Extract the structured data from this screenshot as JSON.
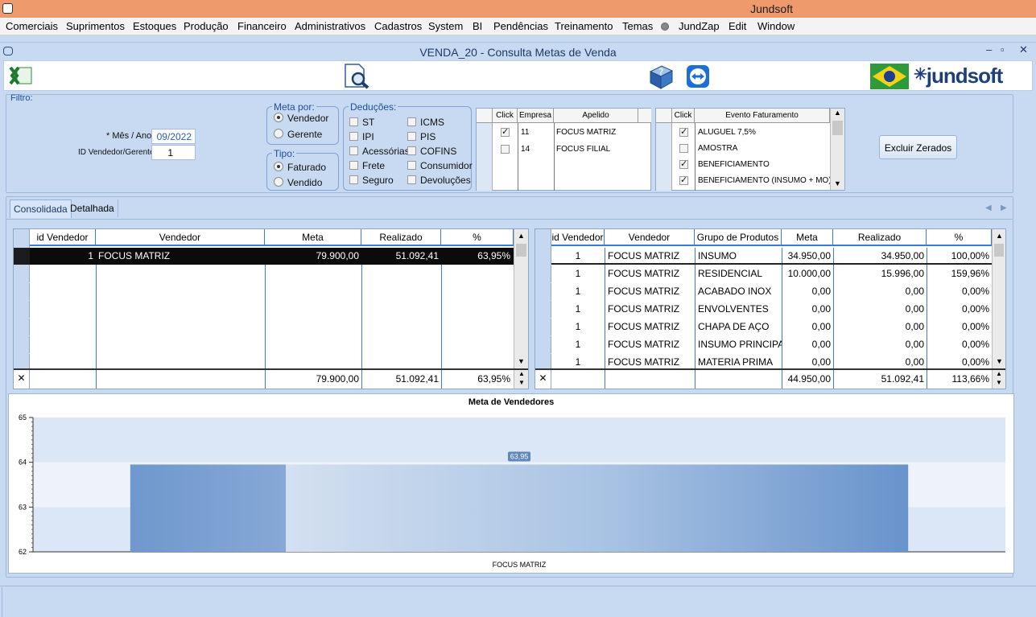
{
  "app_title": "Jundsoft",
  "menu": [
    "Comerciais",
    "Suprimentos",
    "Estoques",
    "Produção",
    "Financeiro",
    "Administrativos",
    "Cadastros",
    "System",
    "BI",
    "Pendências",
    "Treinamento",
    "Temas",
    "JundZap",
    "Edit",
    "Window"
  ],
  "window": {
    "title": "VENDA_20 - Consulta Metas de Venda",
    "controls": [
      "–",
      "▫",
      "✕"
    ]
  },
  "toolbar": {
    "brand": "jundsoft",
    "brand_prefix": "✳"
  },
  "filter": {
    "legend": "Filtro:",
    "mes_ano_label": "* Mês / Ano:",
    "mes_ano_value": "09/2022",
    "id_vendedor_label": "ID Vendedor/Gerente:",
    "id_vendedor_value": "1",
    "meta_por": {
      "legend": "Meta por:",
      "options": [
        "Vendedor",
        "Gerente"
      ],
      "selected": "Vendedor"
    },
    "tipo": {
      "legend": "Tipo:",
      "options": [
        "Faturado",
        "Vendido"
      ],
      "selected": "Faturado"
    },
    "deducoes": {
      "legend": "Deduções:",
      "left": [
        "ST",
        "IPI",
        "Acessórias",
        "Frete",
        "Seguro"
      ],
      "right": [
        "ICMS",
        "PIS",
        "COFINS",
        "Consumidor",
        "Devoluções"
      ]
    },
    "empresas": {
      "headers": [
        "Click",
        "Empresa",
        "Apelido"
      ],
      "rows": [
        {
          "checked": true,
          "id": "11",
          "apelido": "FOCUS MATRIZ"
        },
        {
          "checked": false,
          "id": "14",
          "apelido": "FOCUS FILIAL"
        }
      ]
    },
    "eventos": {
      "headers": [
        "Click",
        "Evento Faturamento"
      ],
      "rows": [
        {
          "checked": true,
          "name": "ALUGUEL 7,5%"
        },
        {
          "checked": false,
          "name": "AMOSTRA"
        },
        {
          "checked": true,
          "name": "BENEFICIAMENTO"
        },
        {
          "checked": true,
          "name": "BENEFICIAMENTO (INSUMO + MO)"
        }
      ]
    },
    "excluir_button": "Excluir Zerados"
  },
  "tabs": [
    "Consolidada",
    "Detalhada"
  ],
  "left_grid": {
    "headers": [
      "id Vendedor",
      "Vendedor",
      "Meta",
      "Realizado",
      "%"
    ],
    "rows": [
      [
        "1",
        "FOCUS MATRIZ",
        "79.900,00",
        "51.092,41",
        "63,95%"
      ]
    ],
    "totals": [
      "",
      "",
      "79.900,00",
      "51.092,41",
      "63,95%"
    ]
  },
  "right_grid": {
    "headers": [
      "id Vendedor",
      "Vendedor",
      "Grupo de Produtos",
      "Meta",
      "Realizado",
      "%"
    ],
    "rows": [
      [
        "1",
        "FOCUS MATRIZ",
        "INSUMO",
        "34.950,00",
        "34.950,00",
        "100,00%"
      ],
      [
        "1",
        "FOCUS MATRIZ",
        "RESIDENCIAL",
        "10.000,00",
        "15.996,00",
        "159,96%"
      ],
      [
        "1",
        "FOCUS MATRIZ",
        "ACABADO INOX",
        "0,00",
        "0,00",
        "0,00%"
      ],
      [
        "1",
        "FOCUS MATRIZ",
        "ENVOLVENTES",
        "0,00",
        "0,00",
        "0,00%"
      ],
      [
        "1",
        "FOCUS MATRIZ",
        "CHAPA DE AÇO",
        "0,00",
        "0,00",
        "0,00%"
      ],
      [
        "1",
        "FOCUS MATRIZ",
        "INSUMO PRINCIPAL",
        "0,00",
        "0,00",
        "0,00%"
      ],
      [
        "1",
        "FOCUS MATRIZ",
        "MATERIA PRIMA",
        "0,00",
        "0,00",
        "0,00%"
      ]
    ],
    "totals": [
      "",
      "",
      "",
      "44.950,00",
      "51.092,41",
      "113,66%"
    ]
  },
  "chart_data": {
    "type": "bar",
    "title": "Meta de Vendedores",
    "categories": [
      "FOCUS MATRIZ"
    ],
    "values": [
      63.95
    ],
    "data_labels": [
      "63,95"
    ],
    "ylim": [
      62,
      65
    ],
    "yticks": [
      "62",
      "63",
      "64",
      "65"
    ],
    "colors": {
      "bar": "#6f98cd",
      "band_a": "#dbe7f6",
      "band_b": "#eef3fb"
    }
  }
}
